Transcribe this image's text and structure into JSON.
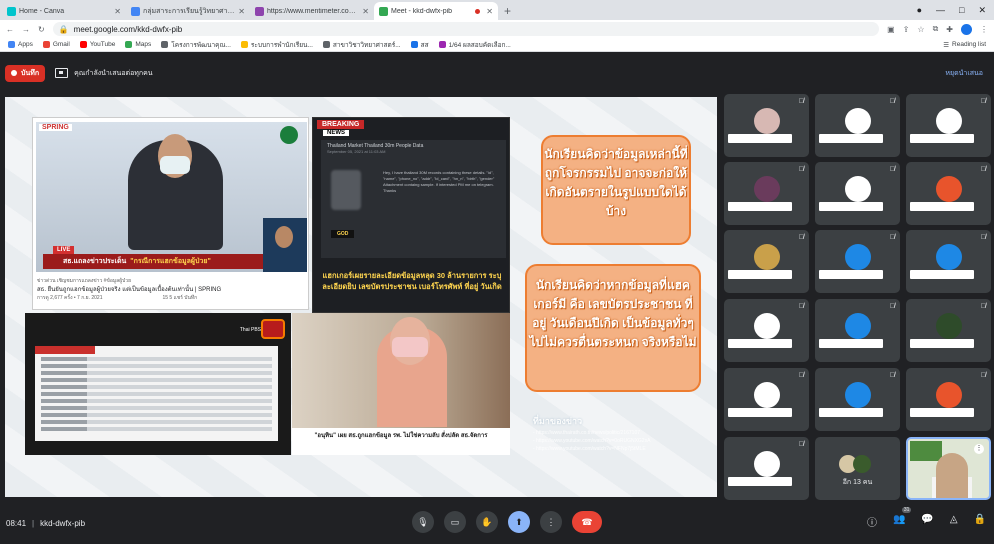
{
  "browser": {
    "tabs": [
      {
        "title": "Home - Canva",
        "color": "#00c4cc"
      },
      {
        "title": "กลุ่มสาระการเรียนรู้วิทยาศาสตร์และเท",
        "color": "#4285f4"
      },
      {
        "title": "https://www.mentimeter.com/s/",
        "color": "#8e44ad"
      },
      {
        "title": "Meet - kkd-dwfx-pib",
        "color": "#34a853"
      }
    ],
    "new_tab": "+",
    "url": "meet.google.com/kkd-dwfx-pib",
    "bookmarks": [
      "Apps",
      "Gmail",
      "YouTube",
      "Maps",
      "โครงการพัฒนาคุณ...",
      "ระบบการพำนักเรียน...",
      "สาขาวิชาวิทยาศาสตร์...",
      "สส",
      "1/64 ผลสอบคัดเลือก..."
    ],
    "reading_list": "Reading list"
  },
  "meet": {
    "record_label": "บันทึก",
    "presenting_label": "คุณกำลังนำเสนอต่อทุกคน",
    "stop_presenting": "หยุดนำเสนอ",
    "time": "08:41",
    "meeting_code": "kkd-dwfx-pib",
    "more_participants": "อีก 13 คน",
    "participant_badge": "31"
  },
  "slide": {
    "bubble1": "นักเรียนคิดว่าข้อมูลเหล่านี้ที่ถูกโจรกรรมไป อาจจะก่อให้เกิดอันตรายในรูปแบบใดได้บ้าง",
    "bubble2": "นักเรียนคิดว่าหากข้อมูลที่แฮคเกอร์มี คือ เลขบัตรประชาชน ที่อยู่ วันเดือนปีเกิด เป็นข้อมูลทั่วๆ ไปไม่ควรตื่นตระหนก จริงหรือไม่",
    "sources_title": "ที่มาของข่าว",
    "sources": [
      "- https://www.thairath.co.th/news/politic/2167107",
      "- https://www.youtube.com/watch?v=0oRUGNXG2sA",
      "- https://www.youtube.com/watch?v=NFNp7j5tMLE"
    ],
    "news1": {
      "brand": "SPRING",
      "live": "LIVE",
      "lower_third": "สธ.แถลงข่าวประเด็น",
      "lower_third_hl": "\"กรณีการแฮกข้อมูลผู้ป่วย\"",
      "meta1": "ข่าวด่วน เชิญชมการแถลงข่าว #ข้อมูลผู้ป่วย",
      "meta2": "สธ. ยืนยันถูกแฮกข้อมูลผู้ป่วยจริง แต่เป็นข้อมูลเบื้องต้นเท่านั้น | SPRING",
      "meta3_views": "การดู 2,677 ครั้ง • 7 ก.ย. 2021",
      "meta3_actions": "15   5   แชร์   บันทึก"
    },
    "news2": {
      "breaking": "BREAKING",
      "news": "NEWS",
      "post_title": "Thailand Market Thailand 30m People Data",
      "post_date": "September 05, 2021 at 11:03 AM",
      "post_body": "Hey, I have thailand 30M records containing these details. \"id\", \"name\", \"phone_no\", \"addr\", \"id_card\", \"hn_n\", \"birth\", \"gender\" Attachment containg sample. If interested PM me on telegram. Thanks",
      "god": "GOD",
      "caption": "แฮกเกอร์เผยรายละเอียดข้อมูลหลุด 30 ล้านรายการ ระบุละเอียดยิบ เลขบัตรประชาชน เบอร์โทรศัพท์ ที่อยู่ วันเกิด"
    },
    "news3": {
      "channel": "Thai PBS"
    },
    "news4": {
      "caption": "\"อนุทิน\" เผย สธ.ถูกแฮกข้อมูล รพ. ไม่ใช่ความลับ สั่งปลัด สธ.จัดการ"
    }
  },
  "colors": {
    "accent": "#8ab4f8",
    "record": "#d93025",
    "bubble": "#f4b183",
    "bubble_border": "#ed7d31"
  }
}
